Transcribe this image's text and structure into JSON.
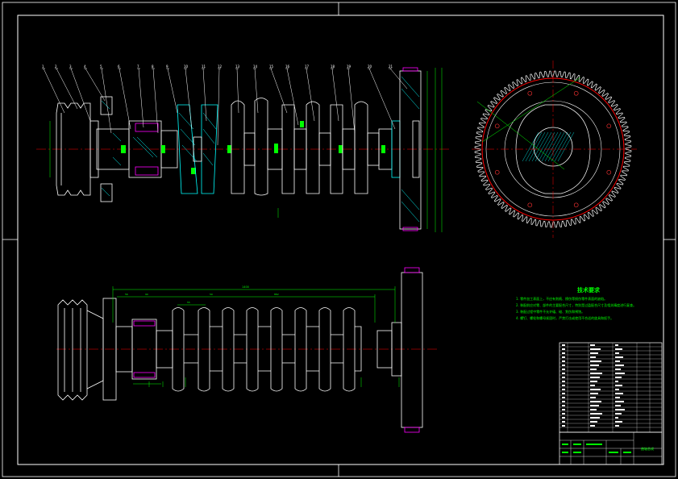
{
  "drawing": {
    "part_balloons": [
      "1",
      "2",
      "3",
      "4",
      "5",
      "6",
      "7",
      "8",
      "9",
      "10",
      "11",
      "12",
      "13",
      "14",
      "15",
      "16",
      "17",
      "18",
      "19",
      "20",
      "21"
    ],
    "tech_notes": {
      "title": "技术要求",
      "items": [
        "1. 零件加工表面上，不应有划痕、擦伤等损伤零件表面的缺陷。",
        "2. 装配前应对零、部件的主要配合尺寸，特别是过盈配合尺寸及相关精度进行复查。",
        "3. 装配过程中零件不允许磕、碰、划伤和锈蚀。",
        "4. 螺钉、螺栓和螺母紧固时，严禁打击或使用不合适的旋具和扳手。"
      ]
    },
    "title_block": {
      "name": "曲轴总成"
    },
    "dimensions": {
      "overall": "1400",
      "d1": "56",
      "d2": "90",
      "d3": "55",
      "d4": "50",
      "d5": "882"
    }
  },
  "colors": {
    "background": "#000000",
    "outline": "#ffffff",
    "centerline": "#ff0000",
    "dimension": "#00ff00",
    "section": "#00ffff",
    "highlight": "#ff00ff"
  }
}
